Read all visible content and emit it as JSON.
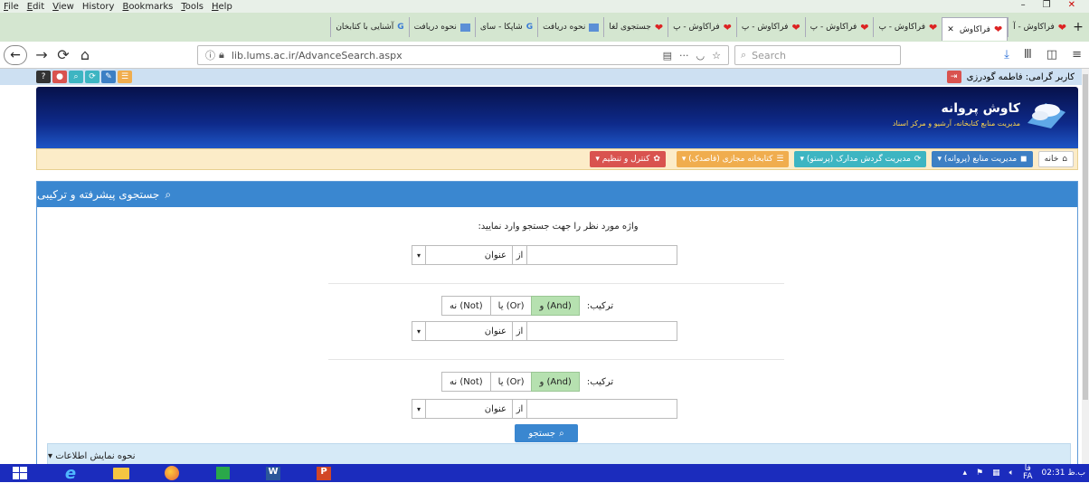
{
  "menubar": {
    "items": [
      {
        "first": "F",
        "rest": "ile"
      },
      {
        "first": "E",
        "rest": "dit"
      },
      {
        "first": "V",
        "rest": "iew"
      },
      {
        "first": "",
        "rest": "History"
      },
      {
        "first": "B",
        "rest": "ookmarks"
      },
      {
        "first": "T",
        "rest": "ools"
      },
      {
        "first": "H",
        "rest": "elp"
      }
    ]
  },
  "tabs": [
    {
      "label": "فراکاوش - آ",
      "icon": "heart-icon",
      "active": false
    },
    {
      "label": "فراکاوش",
      "icon": "heart-icon",
      "active": true
    },
    {
      "label": "فراکاوش - پ",
      "icon": "heart-icon",
      "active": false
    },
    {
      "label": "فراکاوش - پ",
      "icon": "heart-icon",
      "active": false
    },
    {
      "label": "فراکاوش - پ",
      "icon": "heart-icon",
      "active": false
    },
    {
      "label": "فراکاوش - پ",
      "icon": "heart-icon",
      "active": false
    },
    {
      "label": "جستجوی لغا",
      "icon": "heart-icon",
      "active": false
    },
    {
      "label": "نحوه دریافت",
      "icon": "image-icon",
      "active": false
    },
    {
      "label": "شاپکا - سای",
      "icon": "google-icon",
      "active": false
    },
    {
      "label": "نحوه دریافت",
      "icon": "image-icon",
      "active": false
    },
    {
      "label": "آشنایی با کتابخان",
      "icon": "google-icon",
      "active": false
    }
  ],
  "navbar": {
    "url": "lib.lums.ac.ir/AdvanceSearch.aspx",
    "search_placeholder": "Search",
    "more": "···"
  },
  "user": {
    "greeting": "کاربر گرامی: فاطمه گودرزی"
  },
  "logo": {
    "name": "کاوش پروانه",
    "tagline": "مدیریت منابع کتابخانه، آرشیو و مرکز اسناد"
  },
  "menu": {
    "home": "خانه",
    "resources": "مدیریت منابع (پروانه) ▾",
    "circulation": "مدیریت گردش مدارک (پرستو) ▾",
    "digital": "کتابخانه مجازی (قاصدک) ▾",
    "control": "کنترل و تنظیم ▾"
  },
  "panel": {
    "title": "جستجوی پیشرفته و ترکیبی",
    "prompt": "واژه مورد نظر را جهت جستجو وارد نمایید:",
    "field_label": "عنوان",
    "from_label": "از",
    "combine_label": "ترکیب:",
    "and_label": "و (And)",
    "or_label": "یا (Or)",
    "not_label": "نه (Not)",
    "search_button": "جستجو",
    "display_label": "نحوه نمایش اطلاعات ▾"
  },
  "clock": {
    "time": "ب.ظ 02:31",
    "lang": "فا",
    "lang2": "FA"
  }
}
